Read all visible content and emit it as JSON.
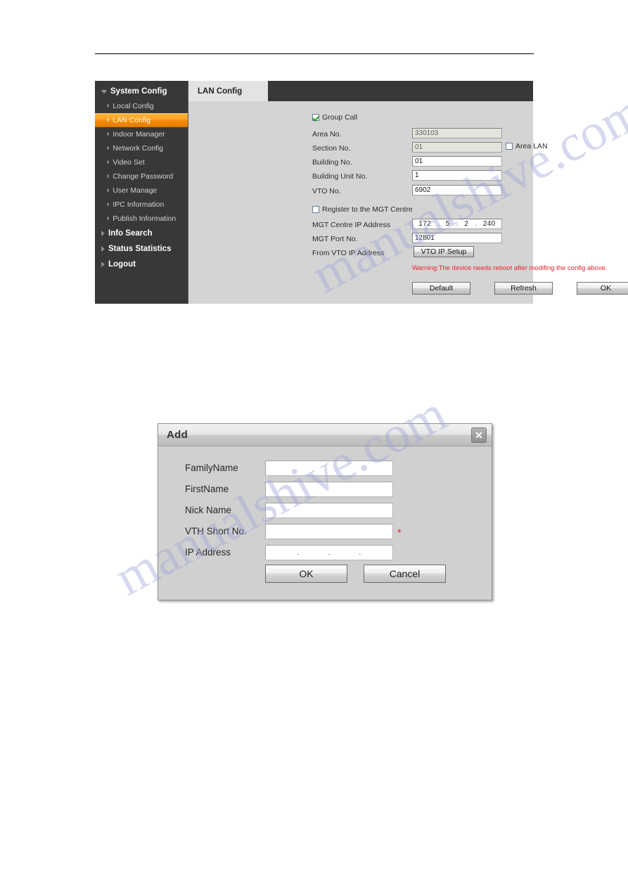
{
  "webui": {
    "sidebar": {
      "groups": [
        {
          "label": "System Config",
          "icon": "triangle-down-icon"
        },
        {
          "label": "Info Search",
          "icon": "triangle-right-icon"
        },
        {
          "label": "Status Statistics",
          "icon": "triangle-right-icon"
        },
        {
          "label": "Logout",
          "icon": "triangle-right-icon"
        }
      ],
      "items": [
        {
          "label": "Local Config",
          "selected": false
        },
        {
          "label": "LAN Config",
          "selected": true
        },
        {
          "label": "Indoor Manager",
          "selected": false
        },
        {
          "label": "Network Config",
          "selected": false
        },
        {
          "label": "Video Set",
          "selected": false
        },
        {
          "label": "Change Password",
          "selected": false
        },
        {
          "label": "User Manage",
          "selected": false
        },
        {
          "label": "IPC Information",
          "selected": false
        },
        {
          "label": "Publish Information",
          "selected": false
        }
      ],
      "chevron": "›",
      "selected_color": "#f5a01e"
    },
    "tab": {
      "label": "LAN Config"
    },
    "form": {
      "group_call": {
        "label": "Group Call",
        "checked": true
      },
      "area_no": {
        "label": "Area No.",
        "value": "330103",
        "disabled": true
      },
      "section_no": {
        "label": "Section No.",
        "value": "01",
        "disabled": true
      },
      "area_lan": {
        "label": "Area LAN",
        "checked": false
      },
      "building_no": {
        "label": "Building No.",
        "value": "01",
        "disabled": false
      },
      "building_unit_no": {
        "label": "Building Unit No.",
        "value": "1",
        "disabled": false
      },
      "vto_no": {
        "label": "VTO No.",
        "value": "6902",
        "disabled": false
      },
      "register_mgt": {
        "label": "Register to the MGT Centre",
        "checked": false
      },
      "mgt_ip": {
        "label": "MGT Centre IP Address",
        "octets": [
          "172",
          "5",
          "2",
          "240"
        ],
        "separator": "."
      },
      "mgt_port": {
        "label": "MGT Port No.",
        "value": "12801"
      },
      "from_vto_ip": {
        "label": "From VTO IP Address",
        "button": "VTO IP Setup"
      },
      "warning": "Warning:The device needs reboot after modifing the config above.",
      "warning_color": "#e8212b"
    },
    "actions": [
      {
        "label": "Default"
      },
      {
        "label": "Refresh"
      },
      {
        "label": "OK"
      }
    ]
  },
  "dialog": {
    "title": "Add",
    "close_icon": "close-icon",
    "close_glyph": "✕",
    "fields": [
      {
        "label": "FamilyName",
        "value": "",
        "required": false,
        "type": "text"
      },
      {
        "label": "FirstName",
        "value": "",
        "required": false,
        "type": "text"
      },
      {
        "label": "Nick Name",
        "value": "",
        "required": false,
        "type": "text"
      },
      {
        "label": "VTH Short No.",
        "value": "",
        "required": true,
        "type": "text"
      },
      {
        "label": "IP Address",
        "value": "",
        "required": false,
        "type": "ip"
      }
    ],
    "required_mark": "*",
    "ip_separator": ".",
    "buttons": [
      {
        "label": "OK"
      },
      {
        "label": "Cancel"
      }
    ]
  },
  "watermark": {
    "line1": "manualshive.com",
    "line2": "manualshive.com"
  }
}
